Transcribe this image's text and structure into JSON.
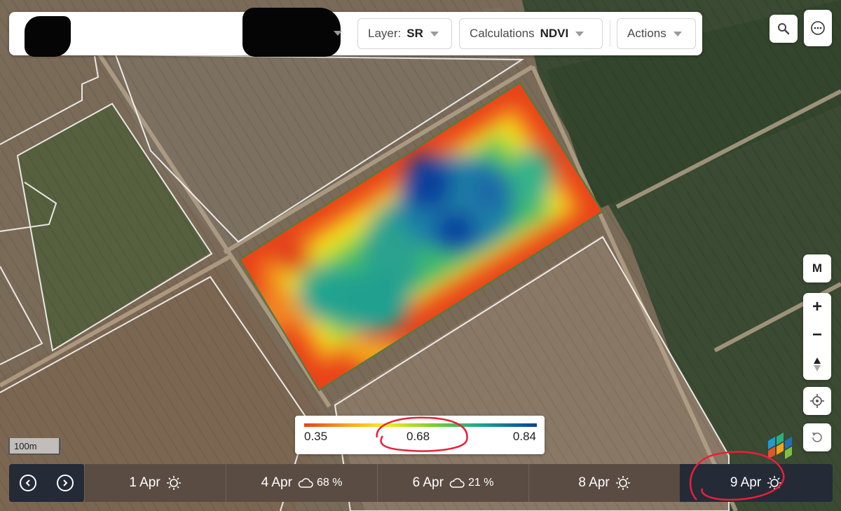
{
  "toolbar": {
    "layer_label": "Layer:",
    "layer_value": "SR",
    "calc_label": "Calculations",
    "calc_value": "NDVI",
    "actions_label": "Actions"
  },
  "controls": {
    "search_icon": "search-icon",
    "more_icon": "more-options-icon",
    "map_mode_label": "M",
    "zoom_in_label": "+",
    "zoom_out_label": "−"
  },
  "scale": {
    "label": "100m"
  },
  "legend": {
    "min": "0.35",
    "mid": "0.68",
    "max": "0.84",
    "colors": [
      "#e8401c",
      "#f7a21d",
      "#f6ef1e",
      "#7ccf2c",
      "#19a98e",
      "#0d3f9d"
    ]
  },
  "timeline": {
    "days": [
      {
        "label": "1 Apr",
        "weather": "sun",
        "cloud": ""
      },
      {
        "label": "4 Apr",
        "weather": "cloud",
        "cloud": "68 %"
      },
      {
        "label": "6 Apr",
        "weather": "cloud",
        "cloud": "21 %"
      },
      {
        "label": "8 Apr",
        "weather": "sun",
        "cloud": ""
      },
      {
        "label": "9 Apr",
        "weather": "sun",
        "cloud": ""
      }
    ],
    "active_index": 4
  },
  "colors": {
    "accent_dark": "#252a37",
    "annotation_red": "#e8203a"
  }
}
